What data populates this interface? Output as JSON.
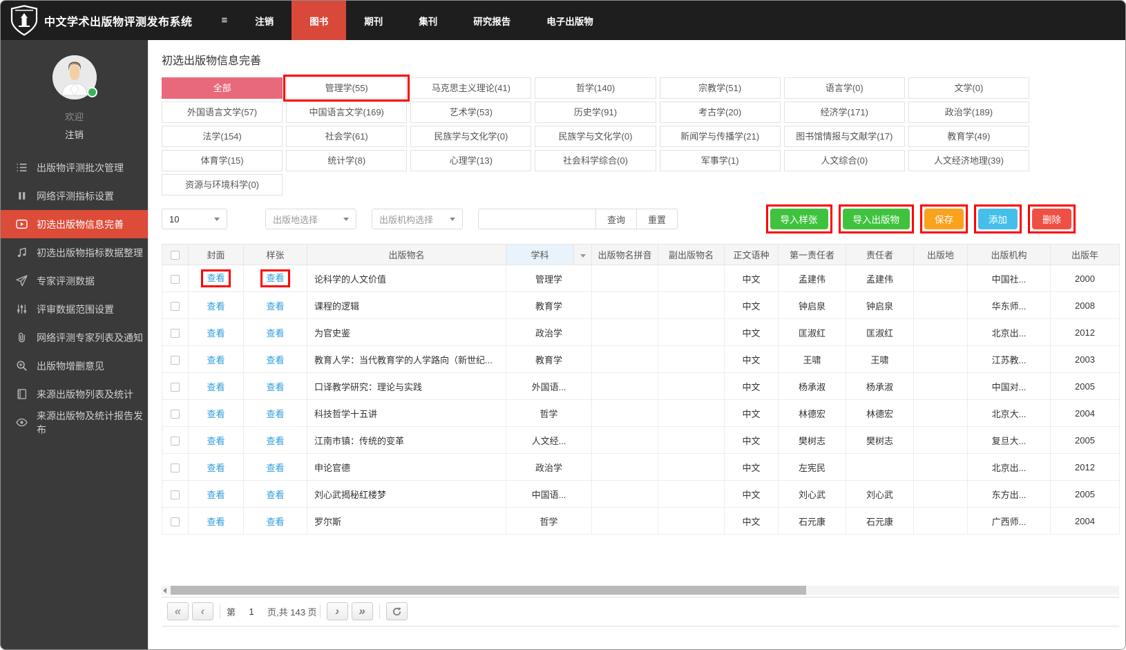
{
  "navbar": {
    "title": "中文学术出版物评测发布系统",
    "menu_toggle": "≡",
    "items": [
      {
        "label": "注销",
        "active": false
      },
      {
        "label": "图书",
        "active": true
      },
      {
        "label": "期刊",
        "active": false
      },
      {
        "label": "集刊",
        "active": false
      },
      {
        "label": "研究报告",
        "active": false
      },
      {
        "label": "电子出版物",
        "active": false
      }
    ]
  },
  "sidebar": {
    "welcome": "欢迎",
    "logout": "注销",
    "items": [
      {
        "label": "出版物评测批次管理",
        "icon": "list-icon",
        "active": false
      },
      {
        "label": "网络评测指标设置",
        "icon": "bars-icon",
        "active": false
      },
      {
        "label": "初选出版物信息完善",
        "icon": "play-circle-icon",
        "active": true
      },
      {
        "label": "初选出版物指标数据整理",
        "icon": "music-icon",
        "active": false
      },
      {
        "label": "专家评测数据",
        "icon": "send-icon",
        "active": false
      },
      {
        "label": "评审数据范围设置",
        "icon": "sliders-icon",
        "active": false
      },
      {
        "label": "网络评测专家列表及通知",
        "icon": "paperclip-icon",
        "active": false
      },
      {
        "label": "出版物增删意见",
        "icon": "zoom-in-icon",
        "active": false
      },
      {
        "label": "来源出版物列表及统计",
        "icon": "book-icon",
        "active": false
      },
      {
        "label": "来源出版物及统计报告发布",
        "icon": "eye-icon",
        "active": false
      }
    ]
  },
  "main": {
    "page_title": "初选出版物信息完善",
    "categories": [
      {
        "label": "全部",
        "active": true,
        "annotated": false
      },
      {
        "label": "管理学(55)",
        "active": false,
        "annotated": true
      },
      {
        "label": "马克思主义理论(41)",
        "active": false,
        "annotated": false
      },
      {
        "label": "哲学(140)",
        "active": false,
        "annotated": false
      },
      {
        "label": "宗教学(51)",
        "active": false,
        "annotated": false
      },
      {
        "label": "语言学(0)",
        "active": false,
        "annotated": false
      },
      {
        "label": "文学(0)",
        "active": false,
        "annotated": false
      },
      {
        "label": "外国语言文学(57)",
        "active": false,
        "annotated": false
      },
      {
        "label": "中国语言文学(169)",
        "active": false,
        "annotated": false
      },
      {
        "label": "艺术学(53)",
        "active": false,
        "annotated": false
      },
      {
        "label": "历史学(91)",
        "active": false,
        "annotated": false
      },
      {
        "label": "考古学(20)",
        "active": false,
        "annotated": false
      },
      {
        "label": "经济学(171)",
        "active": false,
        "annotated": false
      },
      {
        "label": "政治学(189)",
        "active": false,
        "annotated": false
      },
      {
        "label": "法学(154)",
        "active": false,
        "annotated": false
      },
      {
        "label": "社会学(61)",
        "active": false,
        "annotated": false
      },
      {
        "label": "民族学与文化学(0)",
        "active": false,
        "annotated": false
      },
      {
        "label": "民族学与文化学(0)",
        "active": false,
        "annotated": false
      },
      {
        "label": "新闻学与传播学(21)",
        "active": false,
        "annotated": false
      },
      {
        "label": "图书馆情报与文献学(17)",
        "active": false,
        "annotated": false
      },
      {
        "label": "教育学(49)",
        "active": false,
        "annotated": false
      },
      {
        "label": "体育学(15)",
        "active": false,
        "annotated": false
      },
      {
        "label": "统计学(8)",
        "active": false,
        "annotated": false
      },
      {
        "label": "心理学(13)",
        "active": false,
        "annotated": false
      },
      {
        "label": "社会科学综合(0)",
        "active": false,
        "annotated": false
      },
      {
        "label": "军事学(1)",
        "active": false,
        "annotated": false
      },
      {
        "label": "人文综合(0)",
        "active": false,
        "annotated": false
      },
      {
        "label": "人文经济地理(39)",
        "active": false,
        "annotated": false
      },
      {
        "label": "资源与环境科学(0)",
        "active": false,
        "annotated": false
      }
    ],
    "toolbar": {
      "page_size": "10",
      "place_select": "出版地选择",
      "org_select": "出版机构选择",
      "search_button": "查询",
      "reset_button": "重置",
      "actions": [
        {
          "label": "导入样张",
          "color": "#3fc33f",
          "annotated": true
        },
        {
          "label": "导入出版物",
          "color": "#3fc33f",
          "annotated": true
        },
        {
          "label": "保存",
          "color": "#f9a21e",
          "annotated": true
        },
        {
          "label": "添加",
          "color": "#45bfe9",
          "annotated": true
        },
        {
          "label": "删除",
          "color": "#ef5044",
          "annotated": true
        }
      ]
    },
    "table": {
      "headers": [
        "封面",
        "样张",
        "出版物名",
        "学科",
        "出版物名拼音",
        "副出版物名",
        "正文语种",
        "第一责任者",
        "责任者",
        "出版地",
        "出版机构",
        "出版年"
      ],
      "view_label": "查看",
      "rows": [
        {
          "title": "论科学的人文价值",
          "subject": "管理学",
          "pinyin": "",
          "subname": "",
          "lang": "中文",
          "author1": "孟建伟",
          "author2": "孟建伟",
          "place": "",
          "publisher": "中国社...",
          "year": "2000",
          "annotated": true
        },
        {
          "title": "课程的逻辑",
          "subject": "教育学",
          "pinyin": "",
          "subname": "",
          "lang": "中文",
          "author1": "钟启泉",
          "author2": "钟启泉",
          "place": "",
          "publisher": "华东师...",
          "year": "2008",
          "annotated": false
        },
        {
          "title": "为官史鉴",
          "subject": "政治学",
          "pinyin": "",
          "subname": "",
          "lang": "中文",
          "author1": "匡淑红",
          "author2": "匡淑红",
          "place": "",
          "publisher": "北京出...",
          "year": "2012",
          "annotated": false
        },
        {
          "title": "教育人学：当代教育学的人学路向（新世纪...",
          "subject": "教育学",
          "pinyin": "",
          "subname": "",
          "lang": "中文",
          "author1": "王啸",
          "author2": "王啸",
          "place": "",
          "publisher": "江苏教...",
          "year": "2003",
          "annotated": false
        },
        {
          "title": "口译教学研究：理论与实践",
          "subject": "外国语...",
          "pinyin": "",
          "subname": "",
          "lang": "中文",
          "author1": "杨承淑",
          "author2": "杨承淑",
          "place": "",
          "publisher": "中国对...",
          "year": "2005",
          "annotated": false
        },
        {
          "title": "科技哲学十五讲",
          "subject": "哲学",
          "pinyin": "",
          "subname": "",
          "lang": "中文",
          "author1": "林德宏",
          "author2": "林德宏",
          "place": "",
          "publisher": "北京大...",
          "year": "2004",
          "annotated": false
        },
        {
          "title": "江南市镇：传统的变革",
          "subject": "人文经...",
          "pinyin": "",
          "subname": "",
          "lang": "中文",
          "author1": "樊树志",
          "author2": "樊树志",
          "place": "",
          "publisher": "复旦大...",
          "year": "2005",
          "annotated": false
        },
        {
          "title": "申论官德",
          "subject": "政治学",
          "pinyin": "",
          "subname": "",
          "lang": "中文",
          "author1": "左宪民",
          "author2": "",
          "place": "",
          "publisher": "北京出...",
          "year": "2012",
          "annotated": false
        },
        {
          "title": "刘心武揭秘红楼梦",
          "subject": "中国语...",
          "pinyin": "",
          "subname": "",
          "lang": "中文",
          "author1": "刘心武",
          "author2": "刘心武",
          "place": "",
          "publisher": "东方出...",
          "year": "2005",
          "annotated": false
        },
        {
          "title": "罗尔斯",
          "subject": "哲学",
          "pinyin": "",
          "subname": "",
          "lang": "中文",
          "author1": "石元康",
          "author2": "石元康",
          "place": "",
          "publisher": "广西师...",
          "year": "2004",
          "annotated": false
        }
      ]
    },
    "pager": {
      "prefix": "第",
      "current_page": "1",
      "suffix": "页,共 143 页"
    }
  },
  "colors": {
    "navbar_active": "#d9493a",
    "sidebar_active": "#dd4b39",
    "category_active": "#e8697b",
    "link_blue": "#2b9ddb",
    "annotation": "#ff0000"
  }
}
